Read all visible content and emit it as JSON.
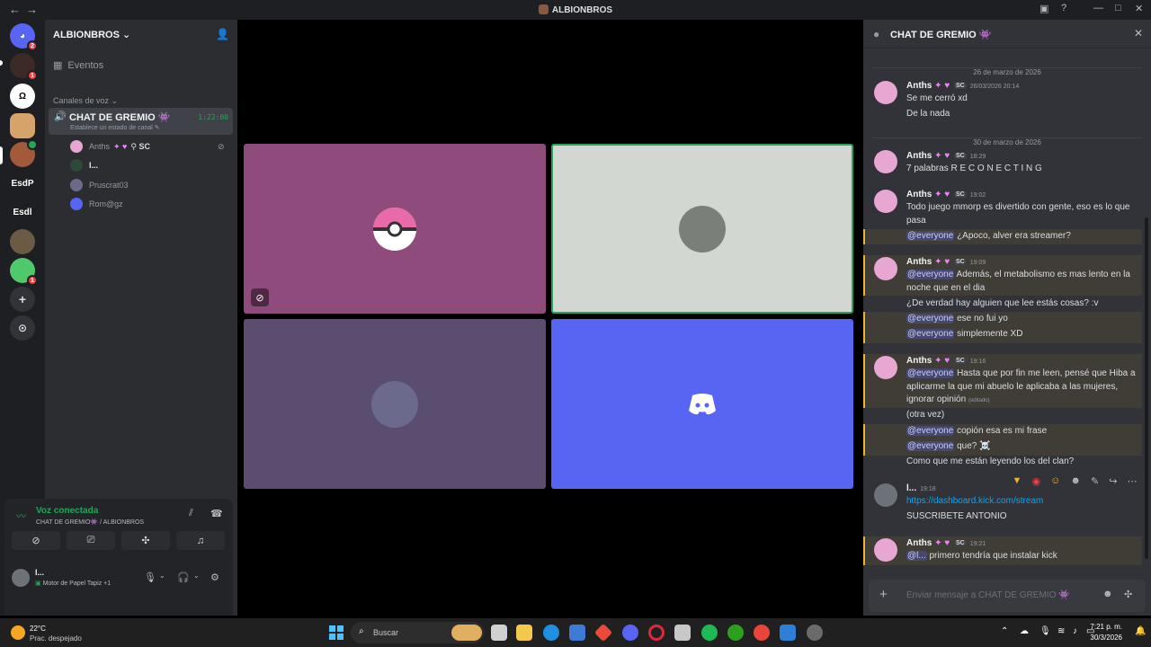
{
  "window": {
    "title": "ALBIONBROS"
  },
  "servers": [
    {
      "label": "",
      "badge": "2"
    },
    {
      "label": "",
      "badge": "1"
    },
    {
      "label": "",
      "badge": ""
    },
    {
      "label": "",
      "badge": ""
    },
    {
      "label": "",
      "badge": ""
    },
    {
      "label": "EsdP",
      "badge": ""
    },
    {
      "label": "Esdl",
      "badge": ""
    },
    {
      "label": "",
      "badge": ""
    },
    {
      "label": "",
      "badge": "1"
    }
  ],
  "guild": {
    "name": "ALBIONBROS",
    "events": "Eventos",
    "voice_category": "Canales de voz"
  },
  "voice_channel": {
    "name": "CHAT DE GREMIO 👾",
    "timer": "1:22:00",
    "status": "Establece un estado de canal"
  },
  "voice_users": [
    {
      "name": "Anths",
      "tags": "SC"
    },
    {
      "name": "l..."
    },
    {
      "name": "Pruscrat03"
    },
    {
      "name": "Rom@gz"
    }
  ],
  "voice_panel": {
    "status": "Voz conectada",
    "location": "CHAT DE GREMIO👾 / ALBIONBROS"
  },
  "user_panel": {
    "name": "l...",
    "activity": "Motor de Papel Tapiz +1"
  },
  "chat": {
    "title": "CHAT DE GREMIO 👾",
    "dates": [
      "26 de marzo de 2026",
      "30 de marzo de 2026"
    ],
    "messages": [
      {
        "author": "Anths",
        "tag": "SC",
        "time": "26/03/2026 20:14",
        "lines": [
          "Se me cerró xd",
          "De la nada"
        ]
      },
      {
        "author": "Anths",
        "tag": "SC",
        "time": "18:29",
        "lines": [
          "7 palabras R E C O N E C T I N G"
        ]
      },
      {
        "author": "Anths",
        "tag": "SC",
        "time": "19:02",
        "lines": [
          "Todo juego mmorp es divertido con gente, eso es lo que pasa"
        ],
        "mention_lines": [
          {
            "mention": "@everyone",
            "text": " ¿Apoco, alver era streamer?"
          }
        ]
      },
      {
        "author": "Anths",
        "tag": "SC",
        "time": "19:09",
        "m1": {
          "mention": "@everyone",
          "text": " Además, el metabolismo es mas lento en la noche que en el dia"
        },
        "plain": "¿De verdad hay alguien que lee estás cosas? :v",
        "m2": {
          "mention": "@everyone",
          "text": " ese no fui yo"
        },
        "m3": {
          "mention": "@everyone",
          "text": " simplemente XD"
        }
      },
      {
        "author": "Anths",
        "tag": "SC",
        "time": "19:16",
        "m1": {
          "mention": "@everyone",
          "text": " Hasta que por fin me leen, pensé que Hiba a aplicarme la que mi abuelo le aplicaba a las mujeres, ignorar opinión",
          "edited": "(editado)"
        },
        "plain1": "(otra vez)",
        "m2": {
          "mention": "@everyone",
          "text": " copión esa es mi frase"
        },
        "m3": {
          "mention": "@everyone",
          "text": " que? ☠️"
        },
        "plain2": "Como que me están leyendo los del clan?"
      },
      {
        "author": "l...",
        "time": "19:18",
        "link": "https://dashboard.kick.com/stream",
        "line": "SUSCRIBETE ANTONIO"
      },
      {
        "author": "Anths",
        "tag": "SC",
        "time": "19:21",
        "mention": "@l...",
        "text": " primero tendría que instalar kick"
      }
    ],
    "input_placeholder": "Enviar mensaje a CHAT DE GREMIO 👾"
  },
  "taskbar": {
    "temp": "22°C",
    "weather": "Prac. despejado",
    "search": "Buscar",
    "time": "7:21 p. m.",
    "date": "30/3/2026"
  },
  "colors": {
    "accent": "#5865f2",
    "online": "#23a55a",
    "tile_pink": "#8e4b7b",
    "tile_gray": "#d3d7d1",
    "tile_purple": "#5a4d70",
    "tile_blurple": "#5865f2"
  }
}
